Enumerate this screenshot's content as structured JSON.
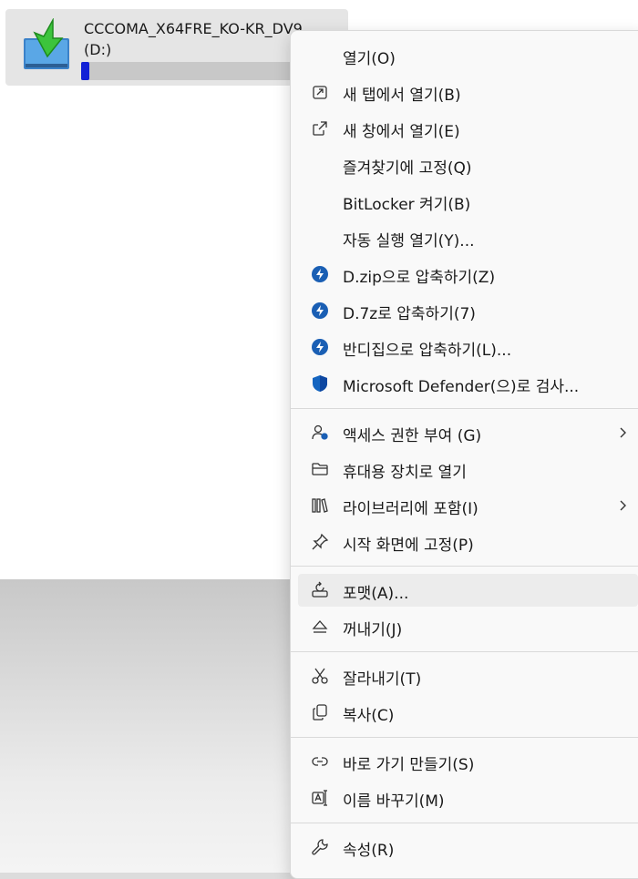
{
  "drive": {
    "name": "CCCOMA_X64FRE_KO-KR_DV9",
    "letter": "(D:)",
    "usage_fraction": 0.03,
    "usage_color": "#1221d6"
  },
  "menu": {
    "open": "열기(O)",
    "open_new_tab": "새 탭에서 열기(B)",
    "open_new_window": "새 창에서 열기(E)",
    "pin_quick_access": "즐겨찾기에 고정(Q)",
    "bitlocker": "BitLocker 켜기(B)",
    "autoplay": "자동 실행 열기(Y)...",
    "zip": "D.zip으로 압축하기(Z)",
    "sevenz": "D.7z로 압축하기(7)",
    "bandizip": "반디집으로 압축하기(L)...",
    "defender": "Microsoft Defender(으)로 검사...",
    "give_access": "액세스 권한 부여 (G)",
    "open_portable": "휴대용 장치로 열기",
    "include_library": "라이브러리에 포함(I)",
    "pin_start": "시작 화면에 고정(P)",
    "format": "포맷(A)...",
    "eject": "꺼내기(J)",
    "cut": "잘라내기(T)",
    "copy": "복사(C)",
    "create_shortcut": "바로 가기 만들기(S)",
    "rename": "이름 바꾸기(M)",
    "properties": "속성(R)"
  },
  "icons": {
    "drive": "drive-install-icon",
    "bandizip": "bandizip-icon",
    "defender": "defender-shield-icon",
    "accent": "#1a5fb4"
  }
}
